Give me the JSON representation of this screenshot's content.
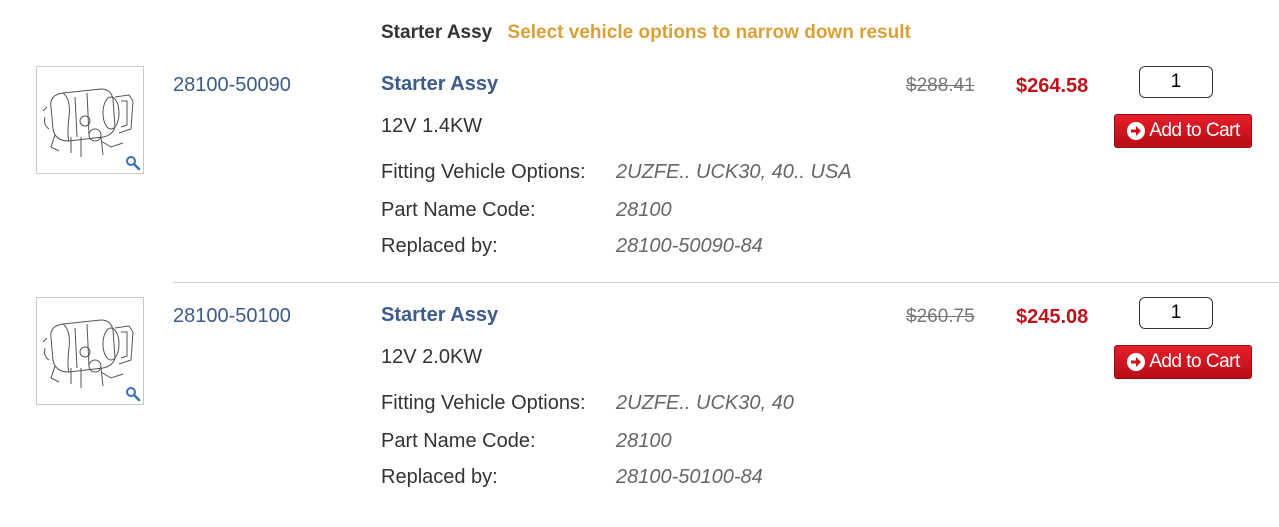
{
  "header": {
    "title": "Starter Assy",
    "hint": "Select vehicle options to narrow down result"
  },
  "labels": {
    "fitting": "Fitting Vehicle Options:",
    "part_name_code": "Part Name Code:",
    "replaced_by": "Replaced by:",
    "add_to_cart": "Add to Cart"
  },
  "colors": {
    "link": "#3c5a8a",
    "hint": "#d9a037",
    "sale": "#c0121b",
    "button": "#c8141e"
  },
  "products": [
    {
      "part_number": "28100-50090",
      "name": "Starter Assy",
      "spec": "12V 1.4KW",
      "fitting": "2UZFE.. UCK30, 40.. USA",
      "part_name_code": "28100",
      "replaced_by": "28100-50090-84",
      "list_price": "$288.41",
      "sale_price": "$264.58",
      "qty": "1"
    },
    {
      "part_number": "28100-50100",
      "name": "Starter Assy",
      "spec": "12V 2.0KW",
      "fitting": "2UZFE.. UCK30, 40",
      "part_name_code": "28100",
      "replaced_by": "28100-50100-84",
      "list_price": "$260.75",
      "sale_price": "$245.08",
      "qty": "1"
    }
  ]
}
